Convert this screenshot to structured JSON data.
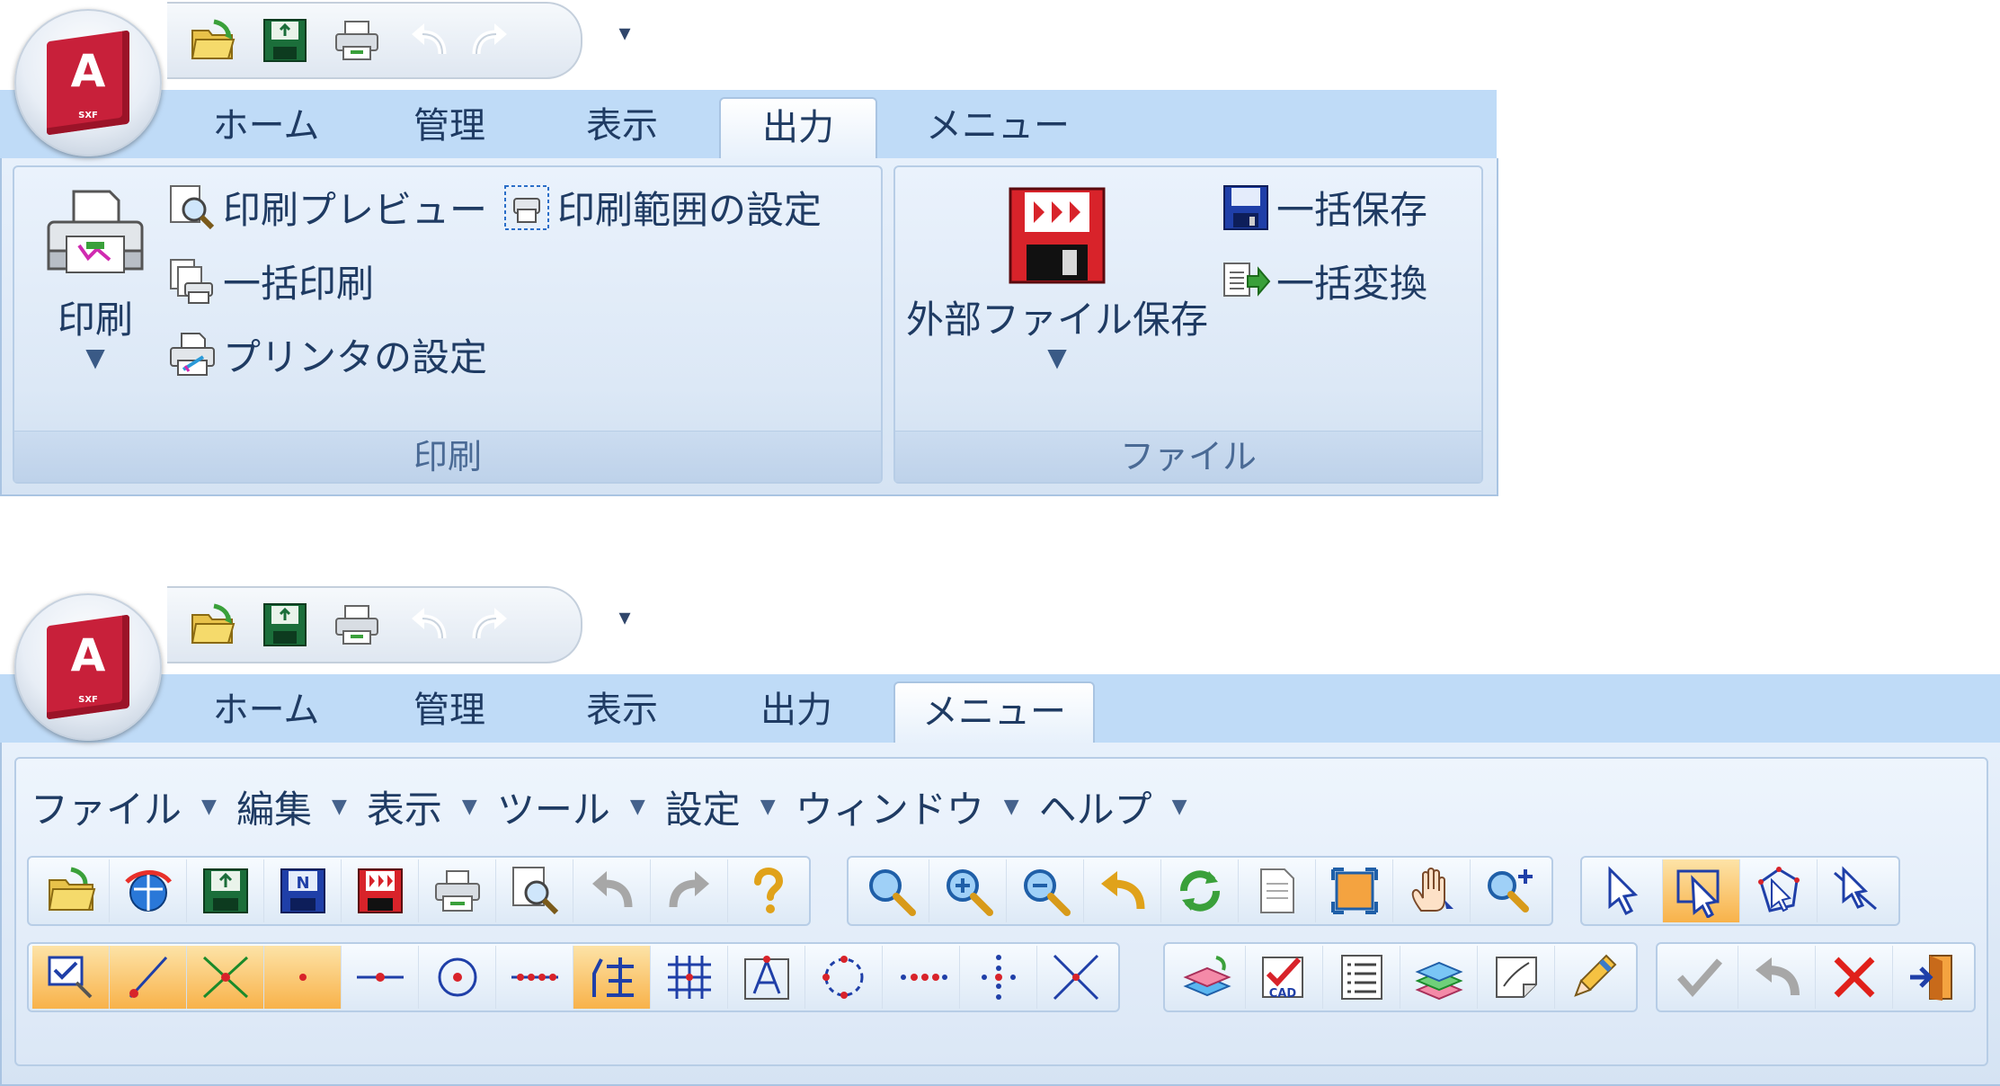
{
  "tabs": [
    "ホーム",
    "管理",
    "表示",
    "出力",
    "メニュー"
  ],
  "top": {
    "active_tab": "出力",
    "group_print": {
      "label": "印刷",
      "big_label": "印刷",
      "preview": "印刷プレビュー",
      "range": "印刷範囲の設定",
      "batch_print": "一括印刷",
      "printer": "プリンタの設定"
    },
    "group_file": {
      "label": "ファイル",
      "big_label": "外部ファイル保存",
      "batch_save": "一括保存",
      "batch_convert": "一括変換"
    }
  },
  "bottom": {
    "active_tab": "メニュー",
    "menus": [
      "ファイル",
      "編集",
      "表示",
      "ツール",
      "設定",
      "ウィンドウ",
      "ヘルプ"
    ]
  },
  "colors": {
    "accent": "#c8203a",
    "tab_strip": "#bfdbf7",
    "highlight": "#f8b24a",
    "text": "#1f3b63"
  }
}
